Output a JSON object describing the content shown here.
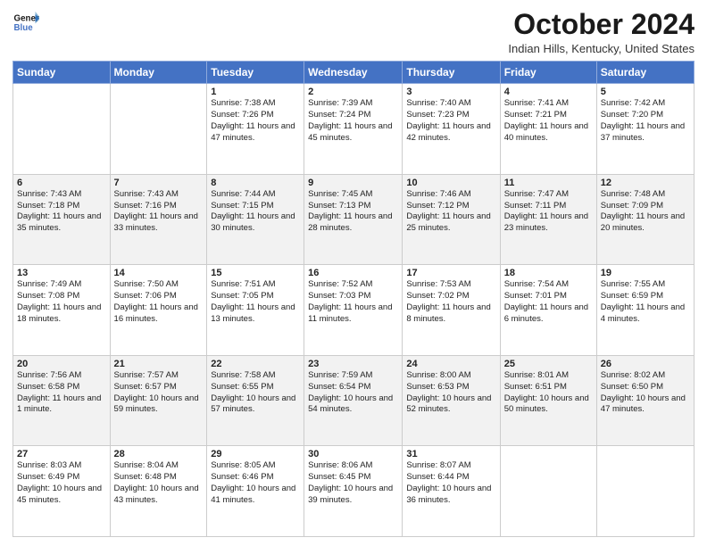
{
  "header": {
    "logo_line1": "General",
    "logo_line2": "Blue",
    "month_title": "October 2024",
    "location": "Indian Hills, Kentucky, United States"
  },
  "days_of_week": [
    "Sunday",
    "Monday",
    "Tuesday",
    "Wednesday",
    "Thursday",
    "Friday",
    "Saturday"
  ],
  "weeks": [
    [
      {
        "day": "",
        "detail": ""
      },
      {
        "day": "",
        "detail": ""
      },
      {
        "day": "1",
        "detail": "Sunrise: 7:38 AM\nSunset: 7:26 PM\nDaylight: 11 hours and 47 minutes."
      },
      {
        "day": "2",
        "detail": "Sunrise: 7:39 AM\nSunset: 7:24 PM\nDaylight: 11 hours and 45 minutes."
      },
      {
        "day": "3",
        "detail": "Sunrise: 7:40 AM\nSunset: 7:23 PM\nDaylight: 11 hours and 42 minutes."
      },
      {
        "day": "4",
        "detail": "Sunrise: 7:41 AM\nSunset: 7:21 PM\nDaylight: 11 hours and 40 minutes."
      },
      {
        "day": "5",
        "detail": "Sunrise: 7:42 AM\nSunset: 7:20 PM\nDaylight: 11 hours and 37 minutes."
      }
    ],
    [
      {
        "day": "6",
        "detail": "Sunrise: 7:43 AM\nSunset: 7:18 PM\nDaylight: 11 hours and 35 minutes."
      },
      {
        "day": "7",
        "detail": "Sunrise: 7:43 AM\nSunset: 7:16 PM\nDaylight: 11 hours and 33 minutes."
      },
      {
        "day": "8",
        "detail": "Sunrise: 7:44 AM\nSunset: 7:15 PM\nDaylight: 11 hours and 30 minutes."
      },
      {
        "day": "9",
        "detail": "Sunrise: 7:45 AM\nSunset: 7:13 PM\nDaylight: 11 hours and 28 minutes."
      },
      {
        "day": "10",
        "detail": "Sunrise: 7:46 AM\nSunset: 7:12 PM\nDaylight: 11 hours and 25 minutes."
      },
      {
        "day": "11",
        "detail": "Sunrise: 7:47 AM\nSunset: 7:11 PM\nDaylight: 11 hours and 23 minutes."
      },
      {
        "day": "12",
        "detail": "Sunrise: 7:48 AM\nSunset: 7:09 PM\nDaylight: 11 hours and 20 minutes."
      }
    ],
    [
      {
        "day": "13",
        "detail": "Sunrise: 7:49 AM\nSunset: 7:08 PM\nDaylight: 11 hours and 18 minutes."
      },
      {
        "day": "14",
        "detail": "Sunrise: 7:50 AM\nSunset: 7:06 PM\nDaylight: 11 hours and 16 minutes."
      },
      {
        "day": "15",
        "detail": "Sunrise: 7:51 AM\nSunset: 7:05 PM\nDaylight: 11 hours and 13 minutes."
      },
      {
        "day": "16",
        "detail": "Sunrise: 7:52 AM\nSunset: 7:03 PM\nDaylight: 11 hours and 11 minutes."
      },
      {
        "day": "17",
        "detail": "Sunrise: 7:53 AM\nSunset: 7:02 PM\nDaylight: 11 hours and 8 minutes."
      },
      {
        "day": "18",
        "detail": "Sunrise: 7:54 AM\nSunset: 7:01 PM\nDaylight: 11 hours and 6 minutes."
      },
      {
        "day": "19",
        "detail": "Sunrise: 7:55 AM\nSunset: 6:59 PM\nDaylight: 11 hours and 4 minutes."
      }
    ],
    [
      {
        "day": "20",
        "detail": "Sunrise: 7:56 AM\nSunset: 6:58 PM\nDaylight: 11 hours and 1 minute."
      },
      {
        "day": "21",
        "detail": "Sunrise: 7:57 AM\nSunset: 6:57 PM\nDaylight: 10 hours and 59 minutes."
      },
      {
        "day": "22",
        "detail": "Sunrise: 7:58 AM\nSunset: 6:55 PM\nDaylight: 10 hours and 57 minutes."
      },
      {
        "day": "23",
        "detail": "Sunrise: 7:59 AM\nSunset: 6:54 PM\nDaylight: 10 hours and 54 minutes."
      },
      {
        "day": "24",
        "detail": "Sunrise: 8:00 AM\nSunset: 6:53 PM\nDaylight: 10 hours and 52 minutes."
      },
      {
        "day": "25",
        "detail": "Sunrise: 8:01 AM\nSunset: 6:51 PM\nDaylight: 10 hours and 50 minutes."
      },
      {
        "day": "26",
        "detail": "Sunrise: 8:02 AM\nSunset: 6:50 PM\nDaylight: 10 hours and 47 minutes."
      }
    ],
    [
      {
        "day": "27",
        "detail": "Sunrise: 8:03 AM\nSunset: 6:49 PM\nDaylight: 10 hours and 45 minutes."
      },
      {
        "day": "28",
        "detail": "Sunrise: 8:04 AM\nSunset: 6:48 PM\nDaylight: 10 hours and 43 minutes."
      },
      {
        "day": "29",
        "detail": "Sunrise: 8:05 AM\nSunset: 6:46 PM\nDaylight: 10 hours and 41 minutes."
      },
      {
        "day": "30",
        "detail": "Sunrise: 8:06 AM\nSunset: 6:45 PM\nDaylight: 10 hours and 39 minutes."
      },
      {
        "day": "31",
        "detail": "Sunrise: 8:07 AM\nSunset: 6:44 PM\nDaylight: 10 hours and 36 minutes."
      },
      {
        "day": "",
        "detail": ""
      },
      {
        "day": "",
        "detail": ""
      }
    ]
  ]
}
